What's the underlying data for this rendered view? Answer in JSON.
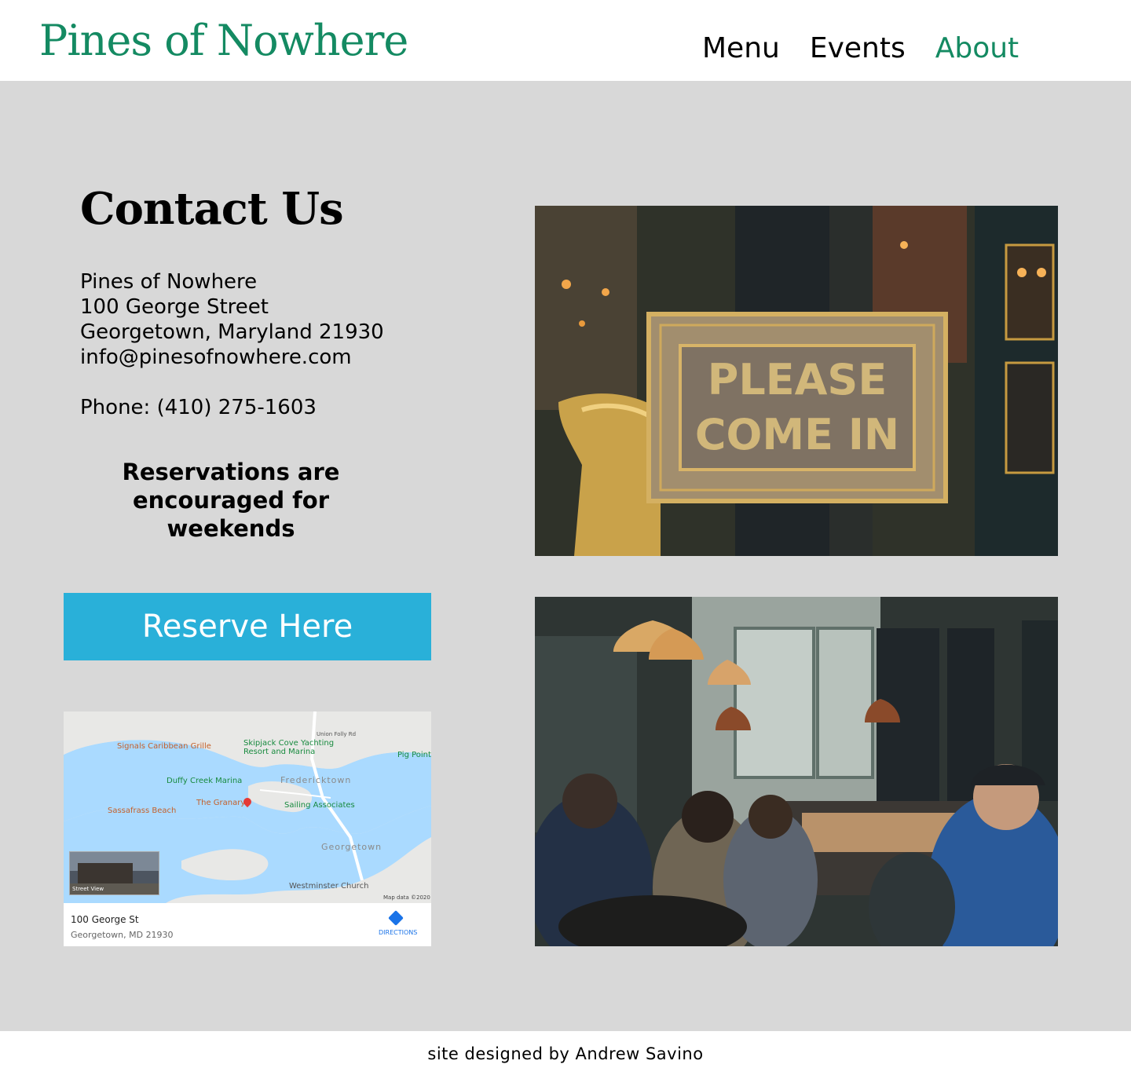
{
  "header": {
    "logo": "Pines of Nowhere",
    "nav": [
      {
        "label": "Menu",
        "active": false
      },
      {
        "label": "Events",
        "active": false
      },
      {
        "label": "About",
        "active": true
      }
    ]
  },
  "contact": {
    "title": "Contact Us",
    "address_lines": [
      "Pines of Nowhere",
      "100 George Street",
      "Georgetown, Maryland 21930",
      "info@pinesofnowhere.com"
    ],
    "phone": "Phone: (410) 275-1603",
    "reservation_note": "Reservations are encouraged for weekends",
    "reserve_button": "Reserve Here"
  },
  "map": {
    "labels": {
      "signals": "Signals Caribbean Grille",
      "skipjack_1": "Skipjack Cove Yachting",
      "skipjack_2": "Resort and Marina",
      "union_folly": "Union Folly Rd",
      "pig_point": "Pig Point",
      "duffy": "Duffy Creek Marina",
      "fredericktown": "Fredericktown",
      "granary": "The Granary",
      "sailing": "Sailing Associates",
      "sassafrass": "Sassafrass Beach",
      "georgetown": "Georgetown",
      "westminster": "Westminster Church",
      "street_view": "Street View",
      "map_data": "Map data ©2020"
    },
    "address_line1": "100 George St",
    "address_line2": "Georgetown, MD 21930",
    "directions": "DIRECTIONS"
  },
  "photos": {
    "sign_line1": "PLEASE",
    "sign_line2": "COME IN"
  },
  "footer": {
    "credit": "site designed by Andrew Savino"
  },
  "colors": {
    "brand_green": "#148a62",
    "reserve_blue": "#29b0d9",
    "content_bg": "#d8d8d8",
    "water": "#aadaff"
  }
}
